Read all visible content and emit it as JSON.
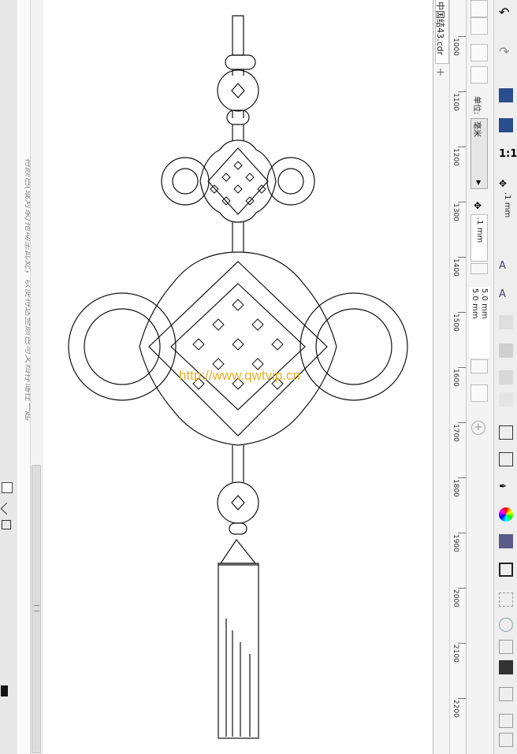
{
  "document": {
    "tab_title": "中国结43.cdr",
    "add_tab": "+"
  },
  "hint": {
    "text": "将颜色(或对象)拖动至此处，以便将这些颜色与文档存储在一起"
  },
  "ruler": {
    "labels": [
      "1000",
      "1100",
      "1200",
      "1300",
      "1400",
      "1500",
      "1600",
      "1700",
      "1800",
      "1900",
      "2000",
      "2100",
      "2200"
    ]
  },
  "property_bar": {
    "units_label": "单位:",
    "units_value": "毫米",
    "nudge_value": ".1 mm",
    "dup_x": "5.0 mm",
    "dup_y": "5.0 mm"
  },
  "right_toolbar": {
    "scale_label": "1:1",
    "nudge_value": ".1 mm"
  },
  "canvas": {
    "watermark": "http://www.qwtvip.cn"
  },
  "colors": {
    "watermark": "#e8b020",
    "canvas_bg": "#ffffff",
    "accent_purple": "#5b5b8a"
  }
}
